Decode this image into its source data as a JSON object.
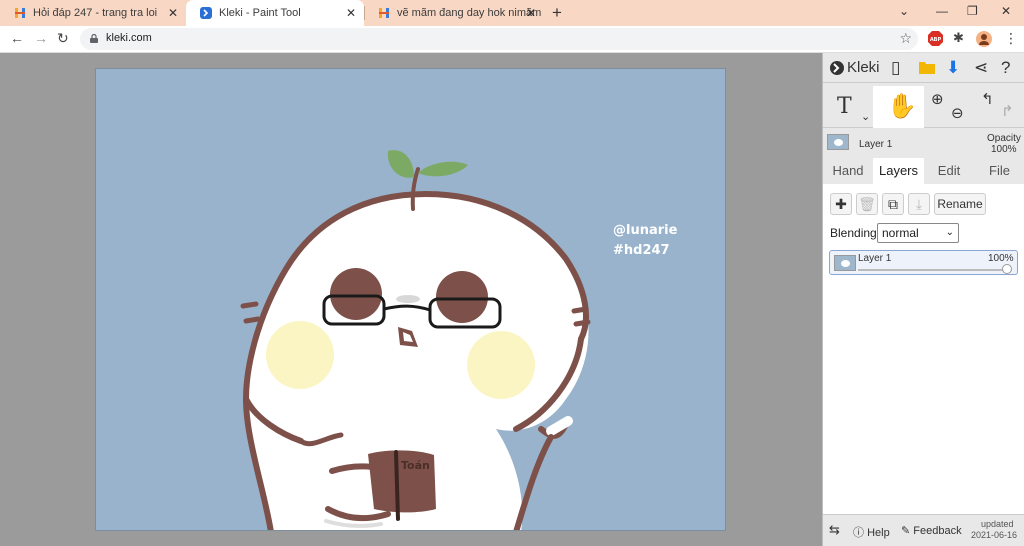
{
  "browser": {
    "tabs": [
      {
        "title": "Hỏi đáp 247 - trang tra loi",
        "favicon": "hoidap-logo-icon",
        "active": false
      },
      {
        "title": "Kleki - Paint Tool",
        "favicon": "kleki-logo-icon",
        "active": true
      },
      {
        "title": "vẽ mãm đang day hok nimãm IC",
        "favicon": "hoidap-logo-icon",
        "active": false
      }
    ],
    "new_tab_label": "+",
    "url": "kleki.com",
    "colors": {
      "tab_strip": "#f8d7c4",
      "active_tab": "#ffffff",
      "omnibox": "#f1f3f4"
    }
  },
  "canvas": {
    "background_color": "#98b3cb",
    "watermark": [
      "@lunarie",
      "#hd247"
    ],
    "book_label": "Toán"
  },
  "panel": {
    "brand": "Kleki",
    "layer_name": "Layer 1",
    "opacity_label": "Opacity",
    "opacity_value": "100%",
    "tabs": [
      "Hand",
      "Layers",
      "Edit",
      "File"
    ],
    "active_tab": "Layers",
    "rename_label": "Rename",
    "blending_label": "Blending",
    "blending_value": "normal",
    "layers": [
      {
        "name": "Layer 1",
        "opacity": "100%"
      }
    ],
    "footer": {
      "help": "Help",
      "feedback": "Feedback",
      "updated_label": "updated",
      "updated_date": "2021-06-16"
    }
  }
}
